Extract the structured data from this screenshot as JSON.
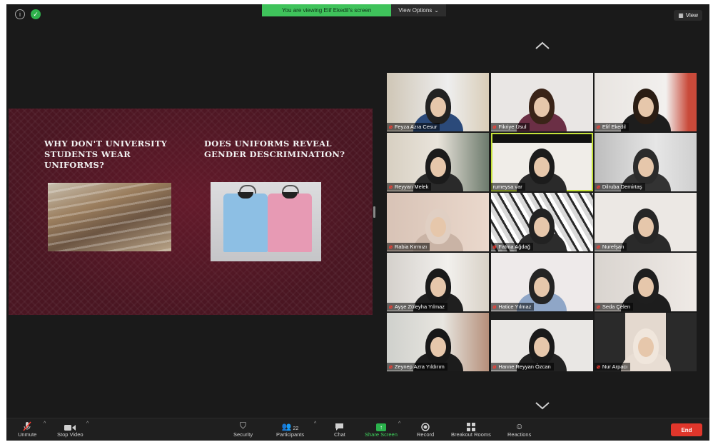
{
  "top": {
    "banner_text": "You are viewing Elif Ekedil's screen",
    "view_options_label": "View Options",
    "view_label": "View"
  },
  "slide": {
    "heading_left": "WHY DON'T UNIVERSITY STUDENTS WEAR UNIFORMS?",
    "heading_right": "DOES UNIFORMS REVEAL GENDER DESCRIMINATION?"
  },
  "participants": [
    {
      "name": "Feyza Azra Cesur",
      "muted": true
    },
    {
      "name": "Fikriye Usul",
      "muted": true
    },
    {
      "name": "Elif Ekedil",
      "muted": true
    },
    {
      "name": "Reyyan Melek",
      "muted": true
    },
    {
      "name": "rumeysa var",
      "muted": false,
      "active": true
    },
    {
      "name": "Dilruba Demirtaş",
      "muted": true
    },
    {
      "name": "Rabia Kırmızı",
      "muted": true
    },
    {
      "name": "Fatma Ağdağ",
      "muted": true
    },
    {
      "name": "Nurefşan",
      "muted": true
    },
    {
      "name": "Ayşe Züleyha Yılmaz",
      "muted": true
    },
    {
      "name": "Hatice Yılmaz",
      "muted": true
    },
    {
      "name": "Seda Çelen",
      "muted": true
    },
    {
      "name": "Zeynep Azra Yıldırım",
      "muted": true
    },
    {
      "name": "Hanne Reyyan Özcan",
      "muted": true
    },
    {
      "name": "Nur Arpacı",
      "muted": true
    }
  ],
  "toolbar": {
    "unmute_label": "Unmute",
    "stop_video_label": "Stop Video",
    "security_label": "Security",
    "participants_label": "Participants",
    "participants_count": "22",
    "chat_label": "Chat",
    "share_screen_label": "Share Screen",
    "record_label": "Record",
    "breakout_label": "Breakout Rooms",
    "reactions_label": "Reactions",
    "end_label": "End"
  },
  "colors": {
    "share_green": "#3fd15c",
    "end_red": "#e0362b",
    "active_speaker": "#c6e23a"
  }
}
